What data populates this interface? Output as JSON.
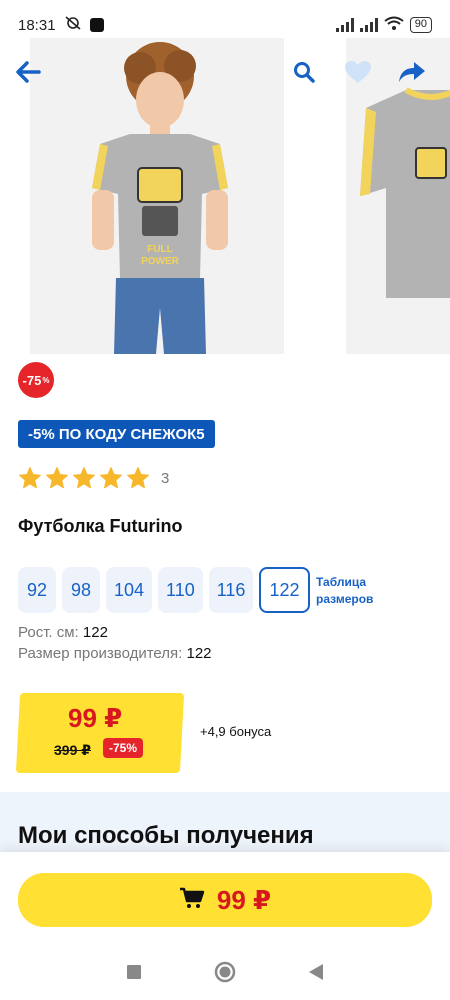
{
  "status_bar": {
    "time": "18:31",
    "battery": "90"
  },
  "icons": {
    "back": "back-arrow-icon",
    "search": "search-icon",
    "favorite": "heart-icon",
    "share": "share-arrow-icon",
    "cart": "cart-icon",
    "star": "star-icon"
  },
  "colors": {
    "accent_blue": "#1862c6",
    "promo_blue": "#0d57b8",
    "sale_red": "#e5252a",
    "price_yellow": "#ffe033",
    "star_gold": "#f6b72b"
  },
  "product": {
    "discount_badge": "-75",
    "discount_badge_sign": "%",
    "promo_code_text": "-5% ПО КОДУ СНЕЖОК5",
    "rating_stars": 5,
    "reviews_count": "3",
    "title": "Футболка Futurino",
    "sizes": [
      "92",
      "98",
      "104",
      "110",
      "116",
      "122"
    ],
    "selected_size": "122",
    "size_table_label_line1": "Таблица",
    "size_table_label_line2": "размеров",
    "height_label": "Рост. см:",
    "height_value": "122",
    "manufacturer_size_label": "Размер производителя:",
    "manufacturer_size_value": "122",
    "price_current": "99 ₽",
    "price_old": "399 ₽",
    "price_discount": "-75%",
    "bonus_text": "+4,9 бонуса"
  },
  "delivery": {
    "title": "Мои способы получения"
  },
  "buy_button": {
    "price": "99 ₽"
  }
}
